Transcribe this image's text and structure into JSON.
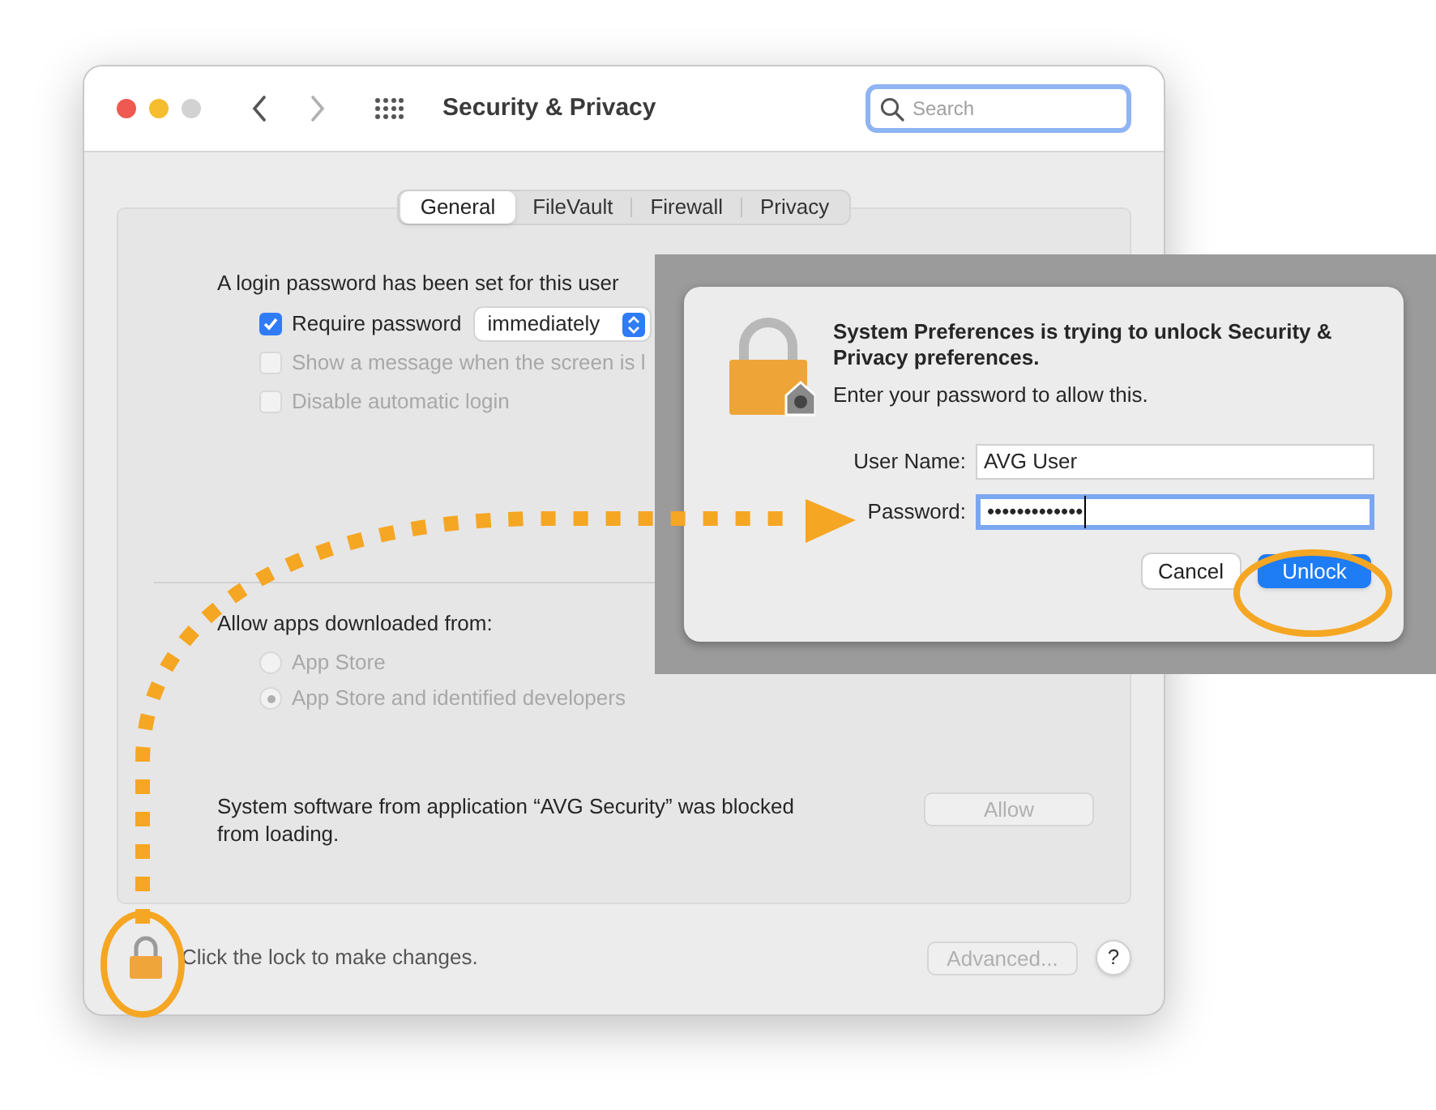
{
  "window": {
    "title": "Security & Privacy",
    "search": {
      "placeholder": "Search"
    }
  },
  "tabs": [
    {
      "label": "General",
      "selected": true
    },
    {
      "label": "FileVault",
      "selected": false
    },
    {
      "label": "Firewall",
      "selected": false
    },
    {
      "label": "Privacy",
      "selected": false
    }
  ],
  "login": {
    "text": "A login password has been set for this user",
    "options": [
      {
        "label": "Require password",
        "checked": true,
        "disabled": false,
        "dropdown": "immediately"
      },
      {
        "label": "Show a message when the screen is l",
        "checked": false,
        "disabled": true
      },
      {
        "label": "Disable automatic login",
        "checked": false,
        "disabled": true
      }
    ]
  },
  "downloads": {
    "label": "Allow apps downloaded from:",
    "options": [
      {
        "label": "App Store",
        "selected": false,
        "disabled": true
      },
      {
        "label": "App Store and identified developers",
        "selected": true,
        "disabled": true
      }
    ]
  },
  "blocked": {
    "text": "System software from application “AVG Security” was blocked from loading.",
    "button": {
      "label": "Allow",
      "disabled": true
    }
  },
  "footer": {
    "lock_text": "Click the lock to make changes.",
    "advanced": {
      "label": "Advanced...",
      "disabled": true
    },
    "help": "?"
  },
  "dialog": {
    "title": "System Preferences is trying to unlock Security & Privacy preferences.",
    "message": "Enter your password to allow this.",
    "fields": [
      {
        "label": "User Name:",
        "value": "AVG User",
        "focused": false
      },
      {
        "label": "Password:",
        "value": "•••••••••••••",
        "focused": true
      }
    ],
    "buttons": [
      {
        "label": "Cancel",
        "default": false
      },
      {
        "label": "Unlock",
        "default": true
      }
    ]
  }
}
